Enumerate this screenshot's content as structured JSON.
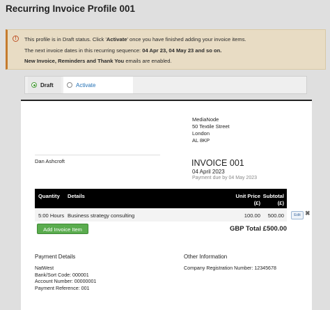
{
  "page_title": "Recurring Invoice Profile 001",
  "alert": {
    "line1_pre": "This profile is in Draft status. Click '",
    "line1_bold": "Activate",
    "line1_post": "' once you have finished adding your invoice items.",
    "line2_pre": "The next invoice dates in this recurring sequence: ",
    "line2_bold": "04 Apr 23, 04 May 23 and so on.",
    "line3_bold": "New Invoice, Reminders and Thank You",
    "line3_post": " emails are enabled."
  },
  "status": {
    "draft_label": "Draft",
    "activate_label": "Activate",
    "selected": "Draft"
  },
  "invoice": {
    "from": [
      "MediaNode",
      "50 Textile Street",
      "London",
      "AL 8KP"
    ],
    "client": "Dan Ashcroft",
    "title": "INVOICE 001",
    "date": "04 April 2023",
    "due": "Payment due by 04 May 2023",
    "headers": {
      "qty": "Quantity",
      "details": "Details",
      "unit_price": "Unit Price",
      "unit_price_cur": "(£)",
      "subtotal": "Subtotal",
      "subtotal_cur": "(£)"
    },
    "items": [
      {
        "qty": "5:00 Hours",
        "details": "Business strategy consulting",
        "unit": "100.00",
        "subtotal": "500.00"
      }
    ],
    "edit_label": "Edit",
    "add_item_label": "Add Invoice Item",
    "total_label": "GBP Total",
    "total_value": "£500.00",
    "payment_title": "Payment Details",
    "payment_lines": [
      "NatWest",
      "Bank/Sort Code: 000001",
      "Account Number: 00000001",
      "Payment Reference: 001"
    ],
    "other_title": "Other Information",
    "other_lines": [
      "Company Registration Number: 12345678"
    ]
  }
}
